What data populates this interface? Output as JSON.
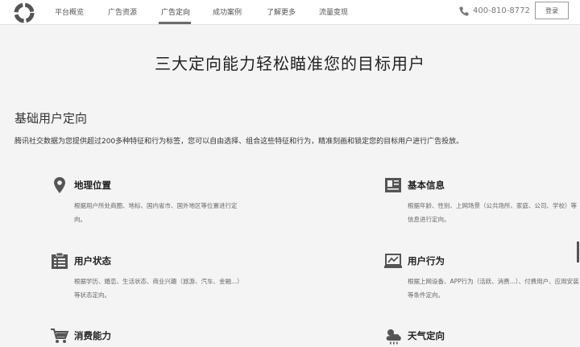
{
  "nav": {
    "items": [
      {
        "label": "平台概览"
      },
      {
        "label": "广告资源"
      },
      {
        "label": "广告定向"
      },
      {
        "label": "成功案例"
      },
      {
        "label": "了解更多"
      },
      {
        "label": "流量变现"
      }
    ],
    "active_item": "广告定向",
    "phone": "400-810-8772",
    "login_label": "登录"
  },
  "hero": {
    "title": "三大定向能力轻松瞄准您的目标用户"
  },
  "section": {
    "title": "基础用户定向",
    "desc": "腾讯社交数据为您提供超过200多种特征和行为标签，您可以自由选择、组合这些特征和行为，精准刻画和锁定您的目标用户进行广告投放。"
  },
  "features": [
    {
      "title": "地理位置",
      "desc": "根据用户所处商圈、地标、国内省市、国外地区等位置进行定向。",
      "icon": "location-pin-icon"
    },
    {
      "title": "基本信息",
      "desc": "根据年龄、性别、上网场景（公共场所、家庭、公司、学校）等信息进行定向。",
      "icon": "profile-card-icon"
    },
    {
      "title": "用户状态",
      "desc": "根据学历、婚恋、生活状态、商业兴趣（旅游、汽车、金融...）等状态定向。",
      "icon": "status-list-icon"
    },
    {
      "title": "用户行为",
      "desc": "根据上网设备、APP行为（活跃、消费...）、付费用户、应用安装等条件定向。",
      "icon": "device-behavior-icon"
    },
    {
      "title": "消费能力",
      "desc": "",
      "icon": "shopping-cart-icon"
    },
    {
      "title": "天气定向",
      "desc": "",
      "icon": "weather-icon"
    }
  ],
  "colors": {
    "background": "#f4f4f4",
    "nav_bg": "#ffffff",
    "icon": "#555555",
    "text": "#222222",
    "muted": "#666666"
  }
}
